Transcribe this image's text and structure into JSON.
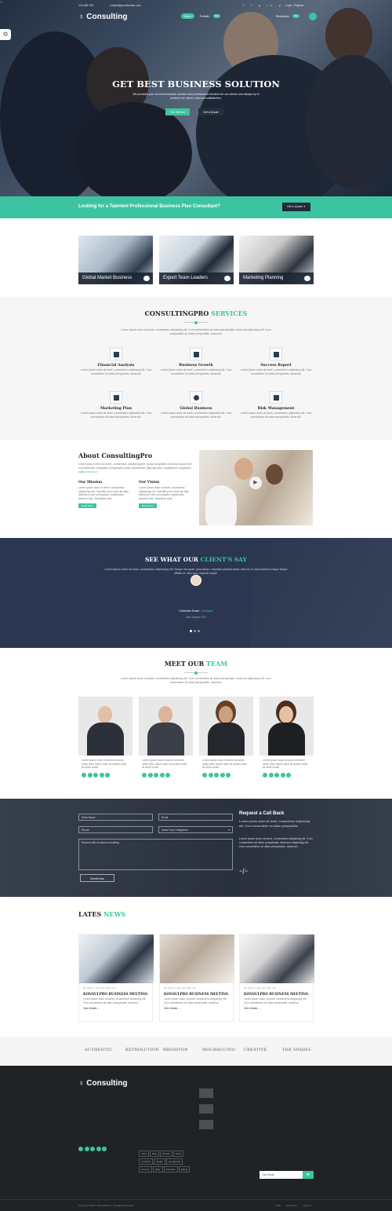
{
  "topbar": {
    "phone": "123-456-789",
    "email": "contact@yourdomain.com",
    "login": "Login / Register"
  },
  "nav": {
    "logo": "Consulting",
    "menu_btn": "Home",
    "item2": "Portfolio",
    "badge2": "New",
    "item3": "Shortcodes",
    "badge3": "New"
  },
  "hero": {
    "title": "GET BEST BUSINESS SOLUTION",
    "desc": "We provides you our best business solution and professional services for our clients and always try to achieve our client's trust and satisfaction.",
    "btn1": "Our Service",
    "btn2": "Get a Quote"
  },
  "cta": {
    "text": "Looking for a Talented Professional Business Plan Consultant?",
    "btn": "Get a Quote"
  },
  "features": [
    {
      "label": "Global Market Business"
    },
    {
      "label": "Expert Team Leaders"
    },
    {
      "label": "Marketing Planning"
    }
  ],
  "services": {
    "title1": "CONSULTINGPRO",
    "title2": "SERVICES",
    "sub": "Lorem ipsum dolor sit amet, consectetur adipiscing elit. Cum consectetur sit ullam perspiciatis, deserunt adipiscing elit. Cum consectetur sit ullam perspiciatis, deserunt.",
    "items": [
      {
        "title": "Financial Analysis",
        "text": "Lorem ipsum dolor sit amet, consectetur adipiscing elit. Cum consectetur sit ullam perspiciatis, deserunt."
      },
      {
        "title": "Business Growth",
        "text": "Lorem ipsum dolor sit amet, consectetur adipiscing elit. Cum consectetur sit ullam perspiciatis, deserunt."
      },
      {
        "title": "Success Report",
        "text": "Lorem ipsum dolor sit amet, consectetur adipiscing elit. Cum consectetur sit ullam perspiciatis, deserunt."
      },
      {
        "title": "Marketing Plan",
        "text": "Lorem ipsum dolor sit amet, consectetur adipiscing elit. Cum consectetur sit ullam perspiciatis, deserunt."
      },
      {
        "title": "Global Business",
        "text": "Lorem ipsum dolor sit amet, consectetur adipiscing elit. Cum consectetur sit ullam perspiciatis, deserunt."
      },
      {
        "title": "Risk Management",
        "text": "Lorem ipsum dolor sit amet, consectetur adipiscing elit. Cum consectetur sit ullam perspiciatis, deserunt."
      }
    ]
  },
  "about": {
    "title": "About ConsultingPro",
    "text": "Lorem ipsum dolor sit amet, consectetur adipisicing elit. Quas voluptatem maxima neque nihil sunt distinctio voluptates perspiciatis omnis repellendus ipsa aperiam, laudantium voluptatum nulla",
    "more": "read more",
    "mission_t": "Our Mission",
    "mission": "Lorem ipsum dolor sit amet, consectetur adipisicing elit. Expedita porro iusto ab vitae deleniti et velit consequatur repellendus deserunt iste. Molestiae enim",
    "vision_t": "Our Vision",
    "vision": "Lorem ipsum dolor sit amet, consectetur adipisicing elit. Expedita porro iusto ab vitae deleniti et velit consequatur repellendus deserunt iste. Molestiae enim",
    "rm": "Read More"
  },
  "testimonial": {
    "t1": "SEE WHAT OUR",
    "t2": "CLIENT'S SAY",
    "quote": "Lorem ipsum dolor sit amet, consectetur adipisicing elit. Neque est quae, quia ipsum, expedita placeat facilis odio illo ex accusantium eaque itaque officiis et. Vero quo, impedit neque.",
    "name": "Catherine Grace",
    "role": "Designer",
    "date": "26th October 2017"
  },
  "team": {
    "t1": "MEET OUR",
    "t2": "TEAM",
    "sub": "Lorem ipsum dolor sit amet, consectetur adipiscing elit. Cum consectetur sit ullam perspiciatis, deserunt adipiscing elit. Cum consectetur sit ullam perspiciatis, deserunt.",
    "bio": "Lorem ipsum dolor sit amet consecte lorely dolor ipsum dolor sit ameko dolor sit amet conse"
  },
  "form": {
    "name": "Enter Name",
    "email": "Email",
    "phone": "Phone",
    "cat": "Select Your Categories",
    "msg": "Discuss with us about consulting",
    "submit": "Submit Now",
    "title": "Request a Call Back",
    "p1": "Lorem ipsum dolor sit amet, consectetur adipiscing elit. Cum consectetur sit ullam perspiciatis.",
    "p2": "Lorem ipsum dolor sit amet, consectetur adipiscing elit. Cum consectetur sit ullam perspiciatis, deserunt adipiscing elit. Cum consectetur sit ullam perspiciatis, deserunt."
  },
  "news": {
    "t1": "LATES",
    "t2": "NEWS",
    "meta": "By: Admin | June 26, 2015 | 30",
    "title": "KONSULPRO BUSINESS MEETING",
    "text": "Lorem ipsum dolor sit amet, consectetur adipiscing elit. Cum consectetur sit ullam perspiciatis, deserunt.",
    "more": "View Details →"
  },
  "brands": [
    "AUTHENTIC",
    "RETROLUTION",
    "BRIGHTON",
    "MOCHACCINO",
    "CREATIVE",
    "THE SPADES"
  ],
  "footer": {
    "logo": "Consulting",
    "about": "Proin tellent in a libero ut torquente nullam consectetur adipiscing elit ut ultrices. Morbi quod donec sollicitude praesent.",
    "rm": "Read More",
    "addr": "203, Coalin Lane, Behind Hire Point, Melbourne, Australia",
    "phone": "123-456-789",
    "email": "contact@yourdomain.com",
    "web": "www.yourdomain.com",
    "useful": "Useful Links",
    "links1": [
      "Home",
      "About Us",
      "Services",
      "Latest Works",
      "Our Blog",
      "Blog"
    ],
    "links2": [
      "Business",
      "Finance",
      "Consulting",
      "Insurance",
      "Professional"
    ],
    "latest": "Latest News",
    "ln": [
      {
        "t": "PHP Learning",
        "d": "Jan 06, 2015"
      },
      {
        "t": "Web Development",
        "d": "Jan 06, 2015"
      },
      {
        "t": "Spoken English",
        "d": "Jan 06, 2015"
      }
    ],
    "hours": "Opening Hours",
    "days": [
      "Mon - Tues :",
      "Wednes - Thurs :",
      "Fri :",
      "Sun :"
    ],
    "times": [
      "6.00 am - 10.00 pm",
      "8.00 am - 6.00 pm",
      "3.00 pm - 8.00 pm",
      "Closed"
    ],
    "tags_t": "Tags",
    "tags": [
      "news",
      "blog",
      "lifestyle",
      "travel",
      "creatives",
      "design",
      "photograph",
      "sources",
      "slider",
      "business",
      "gallery"
    ],
    "twitter": "Twitter Feed",
    "tweet": "Get it free: blog and high tech to make great images for your social media accounts. https://t.co/LyuzGhbd",
    "tweet_date": "Oct 3, 2017",
    "subs": "Subscribe Now",
    "subs_text": "To get latest news and update keep connected with us by mailing.",
    "subs_text2": "Subscribe to Connect with us!",
    "subs_ph": "Your Email",
    "copy": "Copyright ©2017 ThemeMascot. All Rights Reserved",
    "fl": [
      "FAQ",
      "Help Desk",
      "Support"
    ]
  },
  "colors": {
    "accent": "#3cc4a0",
    "dark": "#2b3650"
  }
}
